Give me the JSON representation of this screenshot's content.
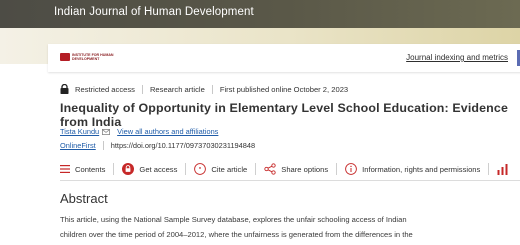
{
  "journal": {
    "title": "Indian Journal of Human Development"
  },
  "publisher": {
    "logo_text": "INSTITUTE FOR HUMAN DEVELOPMENT",
    "indexing_link": "Journal indexing and metrics"
  },
  "meta": {
    "access": "Restricted access",
    "type": "Research article",
    "published": "First published online October 2, 2023"
  },
  "article": {
    "title": "Inequality of Opportunity in Elementary Level School Education: Evidence from India"
  },
  "authors": {
    "name": "Tista Kundu",
    "view_all": "View all authors and affiliations"
  },
  "doi": {
    "label": "OnlineFirst",
    "url": "https://doi.org/10.1177/09737030231194848"
  },
  "toolbar": {
    "contents": "Contents",
    "get_access": "Get access",
    "cite": "Cite article",
    "share": "Share options",
    "info": "Information, rights and permissions"
  },
  "colors": {
    "accent": "#c62828",
    "link": "#1f5ca8",
    "journal_bar": "#4d4c45"
  },
  "abstract": {
    "heading": "Abstract",
    "line1": "This article, using the National Sample Survey database, explores the unfair schooling access of Indian",
    "line2": "children over the time period of 2004–2012, where the unfairness is generated from the differences in the"
  }
}
